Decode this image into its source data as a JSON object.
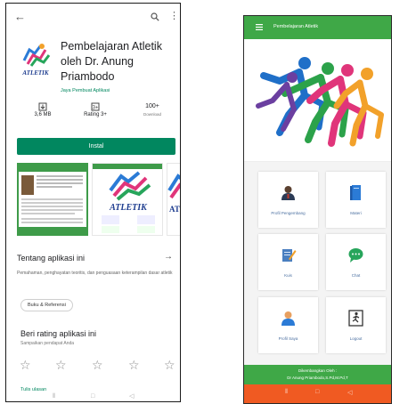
{
  "playstore": {
    "app_title": "Pembelajaran Atletik oleh Dr. Anung Priambodo",
    "developer": "Jaya Pembuat Aplikasi",
    "stats": [
      {
        "value": "3,6 MB",
        "label": ""
      },
      {
        "value": "Rating 3+",
        "label": ""
      },
      {
        "value": "100+",
        "label": "Download"
      }
    ],
    "install_label": "Instal",
    "about_title": "Tentang aplikasi ini",
    "about_arrow": "→",
    "about_desc": "Pemahaman, penghayatan teoritis, dan penguasaan keterampilan dasar atletik",
    "chip_label": "Buku & Referensi",
    "rate_title": "Beri rating aplikasi ini",
    "rate_sub": "Sampaikan pendapat Anda",
    "review_link": "Tulis ulasan",
    "icon_text": "ATLETIK",
    "shot_text": "ATLETIK",
    "shot_text_c": "ATLET"
  },
  "app": {
    "header_title": "Pembelajaran Atletik",
    "tiles": [
      {
        "label": "Profil Pengembang"
      },
      {
        "label": "Materi"
      },
      {
        "label": "Kuis"
      },
      {
        "label": "Chat"
      },
      {
        "label": "Profil Saya"
      },
      {
        "label": "Logout"
      }
    ],
    "footer_line1": "Dikembangkan Oleh :",
    "footer_line2": "Dr Anung Priambodo,S.Pd,M.Pd,T"
  },
  "colors": {
    "play_green": "#01875f",
    "app_green": "#3fa847",
    "nav_orange": "#f05a22"
  }
}
